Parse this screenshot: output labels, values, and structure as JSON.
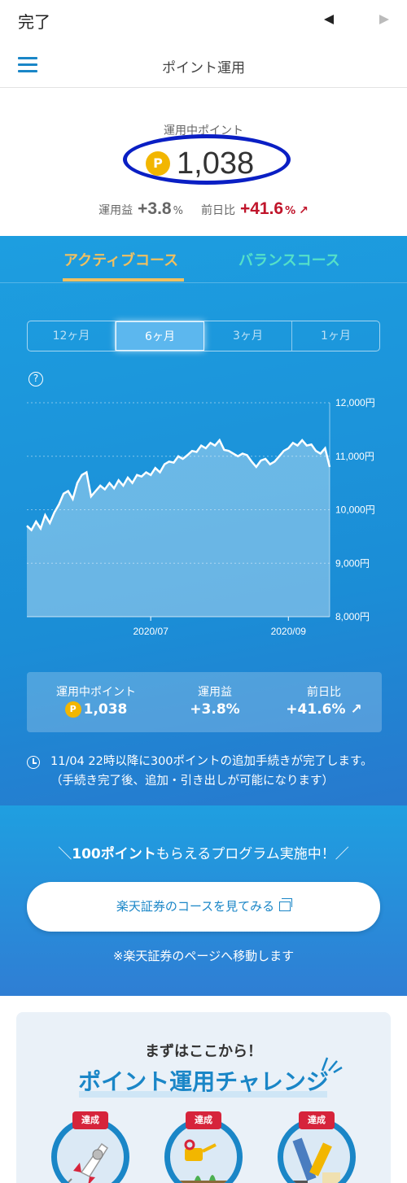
{
  "browser": {
    "done_label": "完了"
  },
  "header": {
    "title": "ポイント運用"
  },
  "summary": {
    "label": "運用中ポイント",
    "points": "1,038",
    "coin": "P",
    "gain_label": "運用益",
    "gain_value": "+3.8",
    "gain_unit": "%",
    "day_label": "前日比",
    "day_value": "+41.6",
    "day_unit": "%",
    "day_arrow": "↗"
  },
  "tabs": [
    {
      "label": "アクティブコース",
      "active": true
    },
    {
      "label": "バランスコース",
      "active": false
    }
  ],
  "periods": [
    {
      "label": "12ヶ月",
      "active": false
    },
    {
      "label": "6ヶ月",
      "active": true
    },
    {
      "label": "3ヶ月",
      "active": false
    },
    {
      "label": "1ヶ月",
      "active": false
    }
  ],
  "help_icon": "?",
  "chart_data": {
    "type": "area",
    "title": "",
    "xlabel": "",
    "ylabel": "",
    "ylim": [
      8000,
      12000
    ],
    "y_ticks": [
      "12,000円",
      "11,000円",
      "10,000円",
      "9,000円",
      "8,000円"
    ],
    "y_tick_values": [
      12000,
      11000,
      10000,
      9000,
      8000
    ],
    "x_ticks": [
      "2020/07",
      "2020/09"
    ],
    "x_tick_index": [
      27,
      57
    ],
    "grid": true,
    "color": "#ffffff",
    "values": [
      9700,
      9620,
      9780,
      9650,
      9900,
      9750,
      9950,
      10100,
      10300,
      10350,
      10200,
      10500,
      10650,
      10700,
      10250,
      10350,
      10450,
      10380,
      10500,
      10400,
      10550,
      10450,
      10600,
      10500,
      10650,
      10620,
      10700,
      10650,
      10780,
      10700,
      10850,
      10900,
      10880,
      11000,
      10950,
      11020,
      11100,
      11080,
      11200,
      11150,
      11250,
      11200,
      11300,
      11120,
      11100,
      11050,
      11000,
      11050,
      11020,
      10900,
      10800,
      10920,
      10950,
      10850,
      10900,
      11000,
      11100,
      11150,
      11250,
      11200,
      11300,
      11200,
      11220,
      11100,
      11050,
      11150,
      10800
    ]
  },
  "mini": {
    "points_label": "運用中ポイント",
    "points_value": "1,038",
    "coin": "P",
    "gain_label": "運用益",
    "gain_value": "+3.8%",
    "day_label": "前日比",
    "day_value": "+41.6%",
    "day_arrow": "↗"
  },
  "notice": "11/04 22時以降に300ポイントの追加手続きが完了します。（手続き完了後、追加・引き出しが可能になります）",
  "program": {
    "prefix": "＼",
    "bold": "100ポイント",
    "rest": "もらえるプログラム実施中！／"
  },
  "cta": {
    "label": "楽天証券のコースを見てみる"
  },
  "move_note": "※楽天証券のページへ移動します",
  "challenge": {
    "subtitle": "まずはここから！",
    "title": "ポイント運用チャレンジ",
    "badges": [
      {
        "tag": "達成",
        "icon": "rocket-icon"
      },
      {
        "tag": "達成",
        "icon": "watering-can-icon"
      },
      {
        "tag": "達成",
        "icon": "pencil-icon"
      }
    ]
  },
  "colors": {
    "accent": "#1a86c7",
    "gain_red": "#c0152b",
    "tab_active": "#f0c060",
    "tab_inactive": "#55e0c8",
    "oval": "#0a1fc4"
  }
}
